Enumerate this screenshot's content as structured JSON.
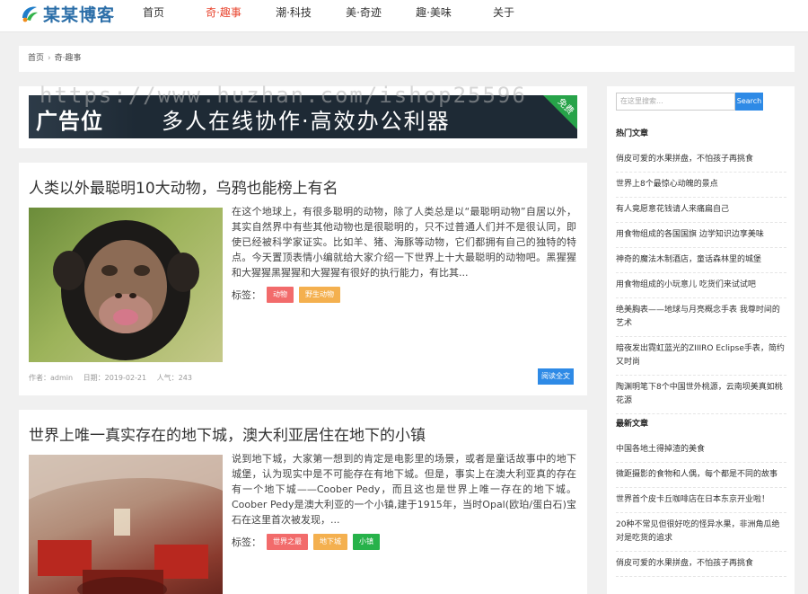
{
  "site": {
    "logo_text": "某某博客"
  },
  "nav": {
    "items": [
      {
        "label": "首页"
      },
      {
        "label": "奇·趣事"
      },
      {
        "label": "潮·科技"
      },
      {
        "label": "美·奇迹"
      },
      {
        "label": "趣·美味"
      },
      {
        "label": "关于"
      }
    ],
    "active_color": "#e8452f"
  },
  "breadcrumb": {
    "home": "首页",
    "sep": "›",
    "current": "奇·趣事"
  },
  "ad": {
    "left_text": "广告位",
    "main_text": "多人在线协作·高效办公利器",
    "corner_text": "免费",
    "watermark": "https://www.huzhan.com/ishop25596"
  },
  "articles": [
    {
      "title": "人类以外最聪明10大动物，乌鸦也能榜上有名",
      "desc": "在这个地球上，有很多聪明的动物，除了人类总是以“最聪明动物”自居以外，其实自然界中有些其他动物也是很聪明的，只不过普通人们并不是很认同，即使已经被科学家证实。比如羊、猪、海豚等动物，它们都拥有自己的独特的特点。今天置顶表情小编就给大家介绍一下世界上十大最聪明的动物吧。黑猩猩和大猩猩黑猩猩和大猩猩有很好的执行能力，有比其...",
      "tags_label": "标签：",
      "tags": [
        {
          "text": "动物",
          "color": "red"
        },
        {
          "text": "野生动物",
          "color": "orange"
        }
      ],
      "author": "作者：admin",
      "date": "日期：2019-02-21",
      "views": "人气：243",
      "read_more": "阅读全文"
    },
    {
      "title": "世界上唯一真实存在的地下城，澳大利亚居住在地下的小镇",
      "desc": "说到地下城，大家第一想到的肯定是电影里的场景，或者是童话故事中的地下城堡，认为现实中是不可能存在有地下城。但是，事实上在澳大利亚真的存在有一个地下城——Coober Pedy，而且这也是世界上唯一存在的地下城。Coober Pedy是澳大利亚的一个小镇,建于1915年，当时Opal(欧珀/蛋白石)宝石在这里首次被发现，...",
      "tags_label": "标签：",
      "tags": [
        {
          "text": "世界之最",
          "color": "red"
        },
        {
          "text": "地下城",
          "color": "orange"
        },
        {
          "text": "小镇",
          "color": "green"
        }
      ]
    }
  ],
  "sidebar": {
    "search_placeholder": "在这里搜索...",
    "search_button": "Search",
    "hot_title": "热门文章",
    "hot": [
      "俏皮可爱的水果拼盘，不怕孩子再挑食",
      "世界上8个最惊心动魄的景点",
      "有人竟愿意花钱请人来痛扁自己",
      "用食物组成的各国国旗 边学知识边享美味",
      "神奇的魔法木制酒店，童话森林里的城堡",
      "用食物组成的小玩意儿 吃货们来试试吧",
      "绝美胸表——地球与月亮概念手表 我尊时间的艺术",
      "暗夜发出霓虹蓝光的ZIIIRO Eclipse手表，简约又时尚",
      "陶渊明笔下8个中国世外桃源，云南坝美真如桃花源"
    ],
    "new_title": "最新文章",
    "new": [
      "中国各地土得掉渣的美食",
      "微距摄影的食物和人偶，每个都是不同的故事",
      "世界首个皮卡丘咖啡店在日本东京开业啦！",
      "20种不常见但很好吃的怪异水果，非洲角瓜绝对是吃货的追求",
      "俏皮可爱的水果拼盘，不怕孩子再挑食"
    ]
  }
}
